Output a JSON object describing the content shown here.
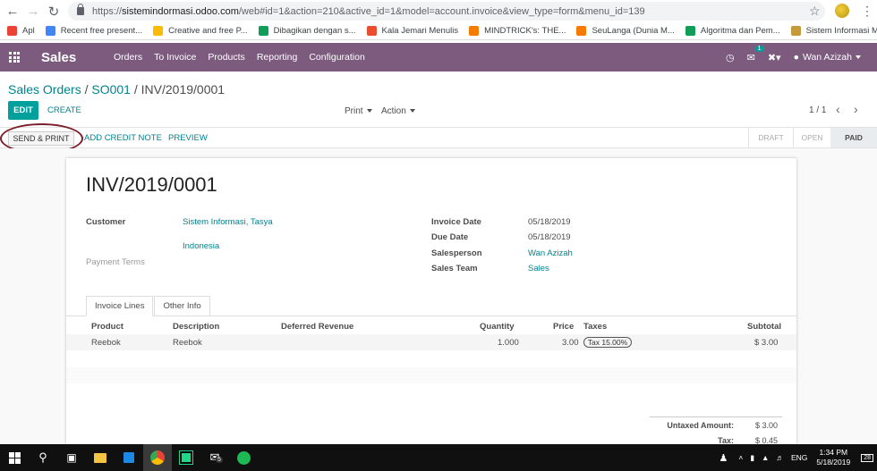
{
  "browser": {
    "url_host": "sistemindormasi.odoo.com",
    "url_path": "/web#id=1&action=210&active_id=1&model=account.invoice&view_type=form&menu_id=139",
    "url_prefix": "https://",
    "bookmarks": [
      {
        "label": "Apl",
        "color": "#ea4335",
        "icon": "apps-grid-icon"
      },
      {
        "label": "Recent free present...",
        "color": "#4285f4",
        "icon": "document-icon"
      },
      {
        "label": "Creative and free P...",
        "color": "#fbbc05",
        "icon": "slides-icon"
      },
      {
        "label": "Dibagikan dengan s...",
        "color": "#0f9d58",
        "icon": "drive-icon"
      },
      {
        "label": "Kala Jemari Menulis",
        "color": "#e94e2f",
        "icon": "page-icon"
      },
      {
        "label": "MINDTRICK's: THE...",
        "color": "#f57c00",
        "icon": "blogger-icon"
      },
      {
        "label": "SeuLanga (Dunia M...",
        "color": "#f57c00",
        "icon": "blogger-icon"
      },
      {
        "label": "Algoritma dan Pem...",
        "color": "#0f9d58",
        "icon": "drive-icon"
      },
      {
        "label": "Sistem Informasi M...",
        "color": "#c49a3a",
        "icon": "logo-icon"
      }
    ]
  },
  "topbar": {
    "brand": "Sales",
    "menu": [
      "Orders",
      "To Invoice",
      "Products",
      "Reporting",
      "Configuration"
    ],
    "chat_count": "1",
    "user": "Wan Azizah",
    "color": "#7c5b7f"
  },
  "control": {
    "breadcrumb": [
      "Sales Orders",
      "SO001",
      "INV/2019/0001"
    ],
    "edit": "EDIT",
    "create": "CREATE",
    "print": "Print",
    "action": "Action",
    "pager": "1 / 1"
  },
  "status": {
    "send_print": "SEND & PRINT",
    "add_credit": "ADD CREDIT NOTE",
    "preview": "PREVIEW",
    "stages": [
      "DRAFT",
      "OPEN",
      "PAID"
    ],
    "active_stage": "PAID"
  },
  "invoice": {
    "number": "INV/2019/0001",
    "customer_label": "Customer",
    "customer": "Sistem Informasi, Tasya",
    "country": "Indonesia",
    "payment_terms_label": "Payment Terms",
    "invoice_date_label": "Invoice Date",
    "invoice_date": "05/18/2019",
    "due_date_label": "Due Date",
    "due_date": "05/18/2019",
    "salesperson_label": "Salesperson",
    "salesperson": "Wan Azizah",
    "sales_team_label": "Sales Team",
    "sales_team": "Sales"
  },
  "tabs": [
    "Invoice Lines",
    "Other Info"
  ],
  "lines": {
    "headers": [
      "Product",
      "Description",
      "Deferred Revenue",
      "Quantity",
      "Price",
      "Taxes",
      "Subtotal"
    ],
    "rows": [
      {
        "product": "Reebok",
        "description": "Reebok",
        "deferred": "",
        "quantity": "1.000",
        "price": "3.00",
        "taxes": "Tax 15.00%",
        "subtotal": "$ 3.00"
      }
    ]
  },
  "totals": {
    "untaxed_label": "Untaxed Amount:",
    "untaxed": "$ 3.00",
    "tax_label": "Tax:",
    "tax": "$ 0.45"
  },
  "taskbar": {
    "time": "1:34 PM",
    "date": "5/18/2019",
    "lang": "ENG",
    "notif": "28",
    "mail_count": "5"
  }
}
